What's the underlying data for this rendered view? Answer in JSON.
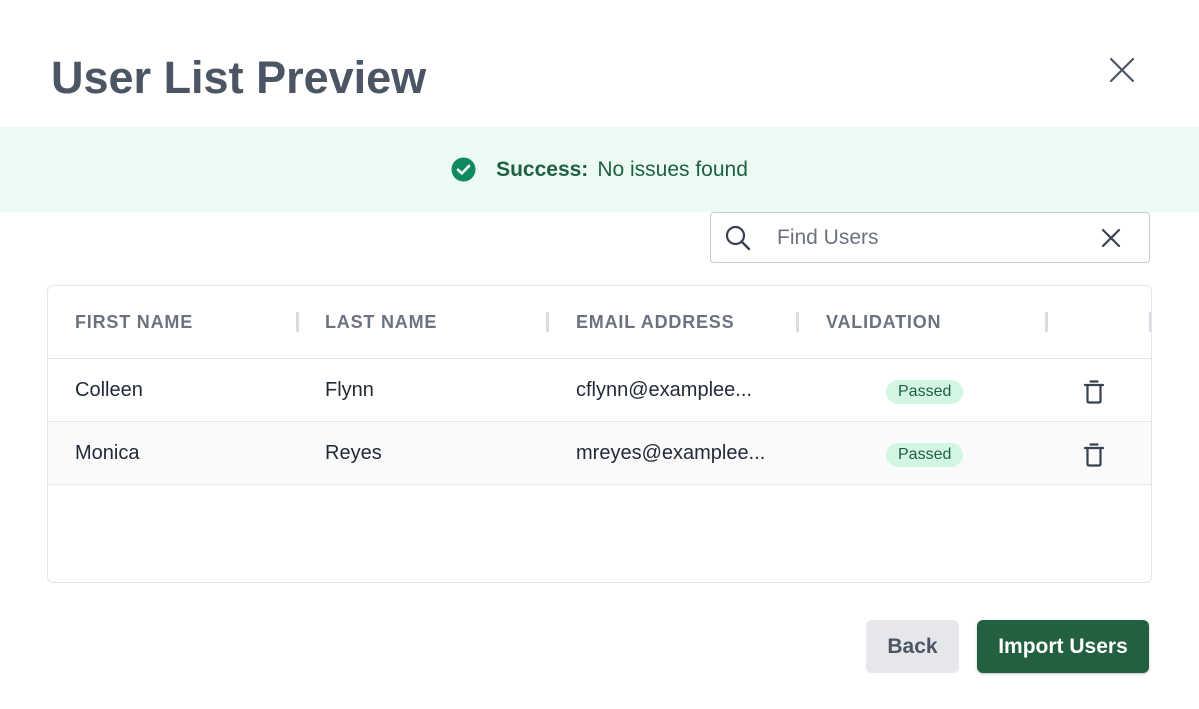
{
  "dialog": {
    "title": "User List Preview"
  },
  "banner": {
    "status": "success",
    "label": "Success:",
    "message": "No issues found",
    "color": "#0f8a5f",
    "background": "#ebfbf3"
  },
  "search": {
    "placeholder": "Find Users",
    "value": "",
    "icon": "search-icon",
    "clear_icon": "close-icon"
  },
  "table": {
    "columns": [
      "FIRST NAME",
      "LAST NAME",
      "EMAIL ADDRESS",
      "VALIDATION"
    ],
    "rows": [
      {
        "first_name": "Colleen",
        "last_name": "Flynn",
        "email": "cflynn@examplee...",
        "validation": "Passed"
      },
      {
        "first_name": "Monica",
        "last_name": "Reyes",
        "email": "mreyes@examplee...",
        "validation": "Passed"
      }
    ]
  },
  "footer": {
    "back_label": "Back",
    "import_label": "Import Users",
    "primary_color": "#22603f"
  }
}
